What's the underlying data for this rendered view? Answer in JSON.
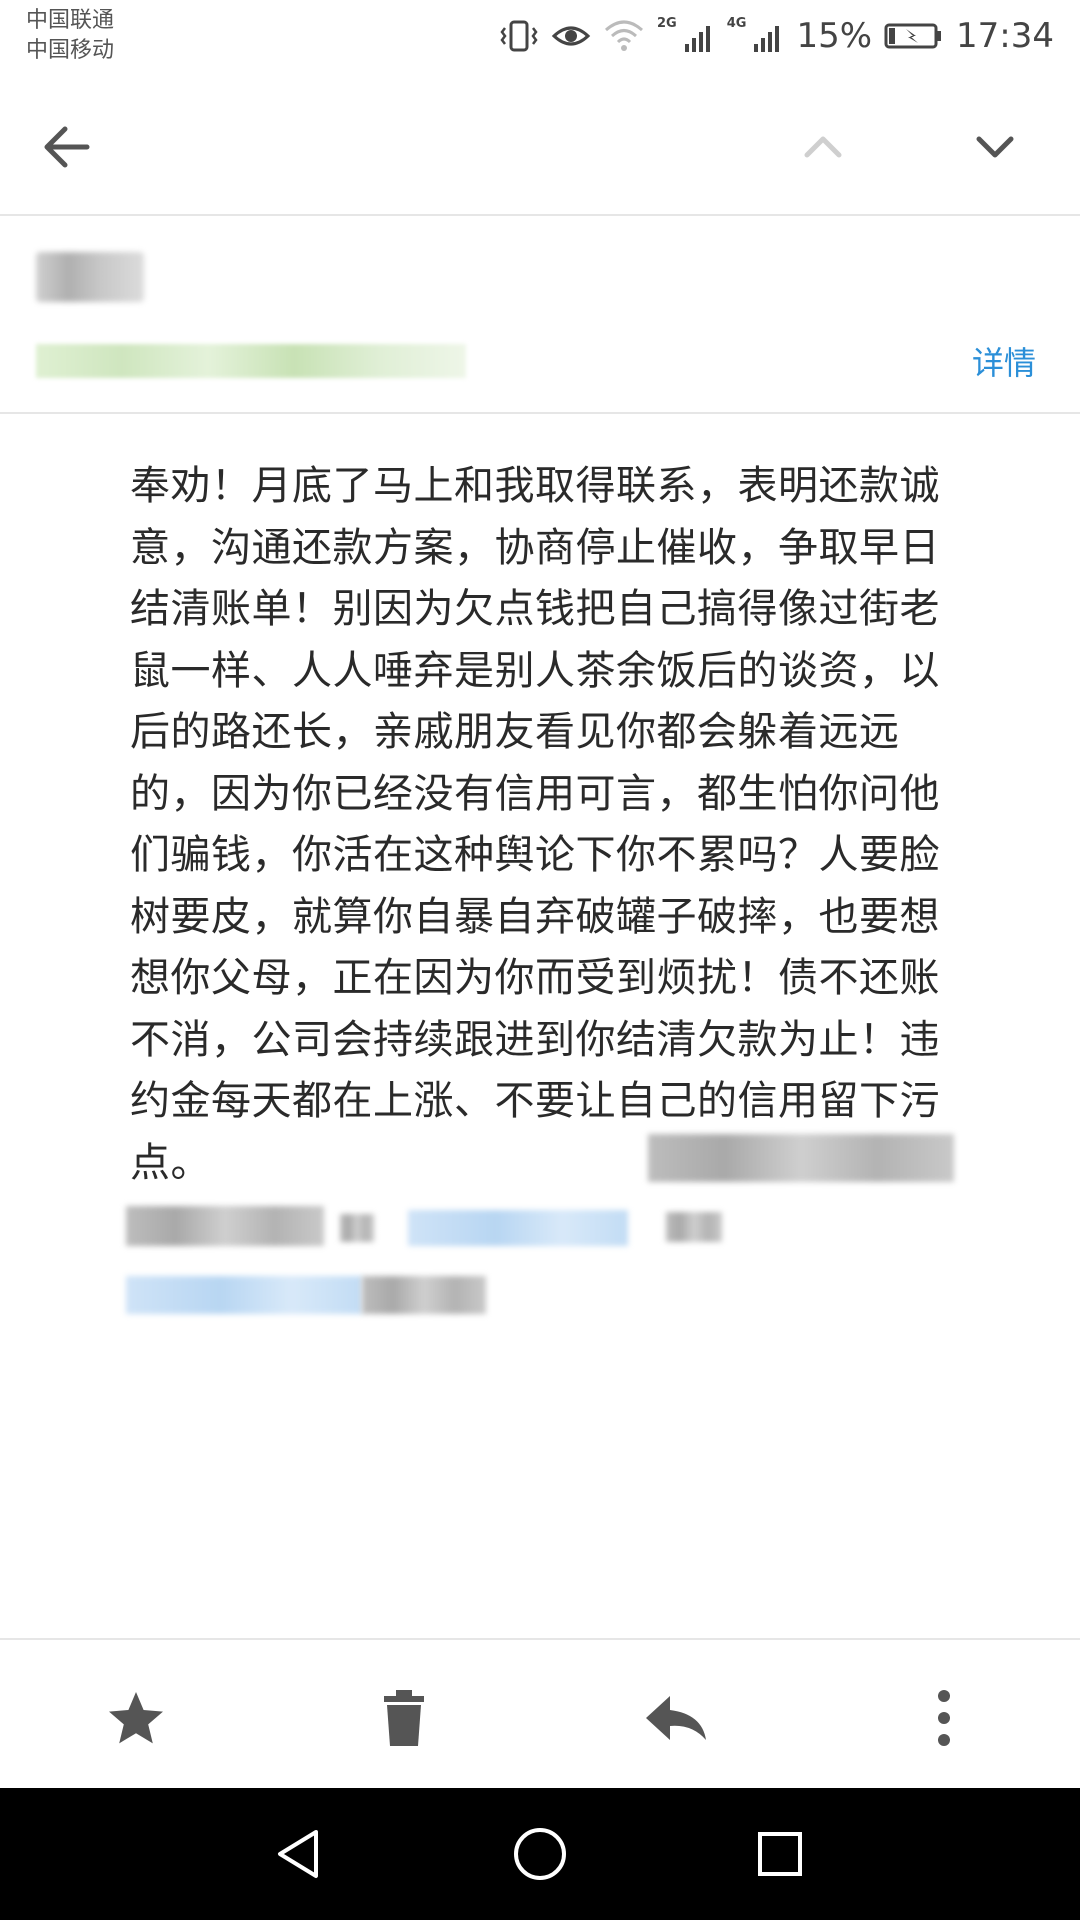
{
  "status_bar": {
    "carrier_1": "中国联通",
    "carrier_2": "中国移动",
    "net_2g": "2G",
    "net_4g": "4G",
    "battery": "15%",
    "clock": "17:34",
    "icons": [
      "vibrate-icon",
      "eye-comfort-icon",
      "wifi-icon",
      "signal-2g-icon",
      "signal-4g-icon",
      "battery-charging-icon"
    ]
  },
  "toolbar": {
    "back_icon": "arrow-left-icon",
    "prev_icon": "chevron-up-icon",
    "next_icon": "chevron-down-icon"
  },
  "header": {
    "details_label": "详情"
  },
  "message": {
    "body": "奉劝！月底了马上和我取得联系，表明还款诚意，沟通还款方案，协商停止催收，争取早日结清账单！别因为欠点钱把自己搞得像过街老鼠一样、人人唾弃是别人茶余饭后的谈资，以后的路还长，亲戚朋友看见你都会躲着远远的，因为你已经没有信用可言，都生怕你问他们骗钱，你活在这种舆论下你不累吗？人要脸树要皮，就算你自暴自弃破罐子破摔，也要想想你父母，正在因为你而受到烦扰！债不还账不消，公司会持续跟进到你结清欠款为止！违约金每天都在上涨、不要让自己的信用留下污点。"
  },
  "actions": {
    "icons": [
      "star-icon",
      "trash-icon",
      "reply-icon",
      "more-vertical-icon"
    ]
  },
  "colors": {
    "link": "#2b8fd8",
    "icon": "#555555",
    "icon_disabled": "#cfcfcf",
    "nav_bg": "#000000"
  }
}
